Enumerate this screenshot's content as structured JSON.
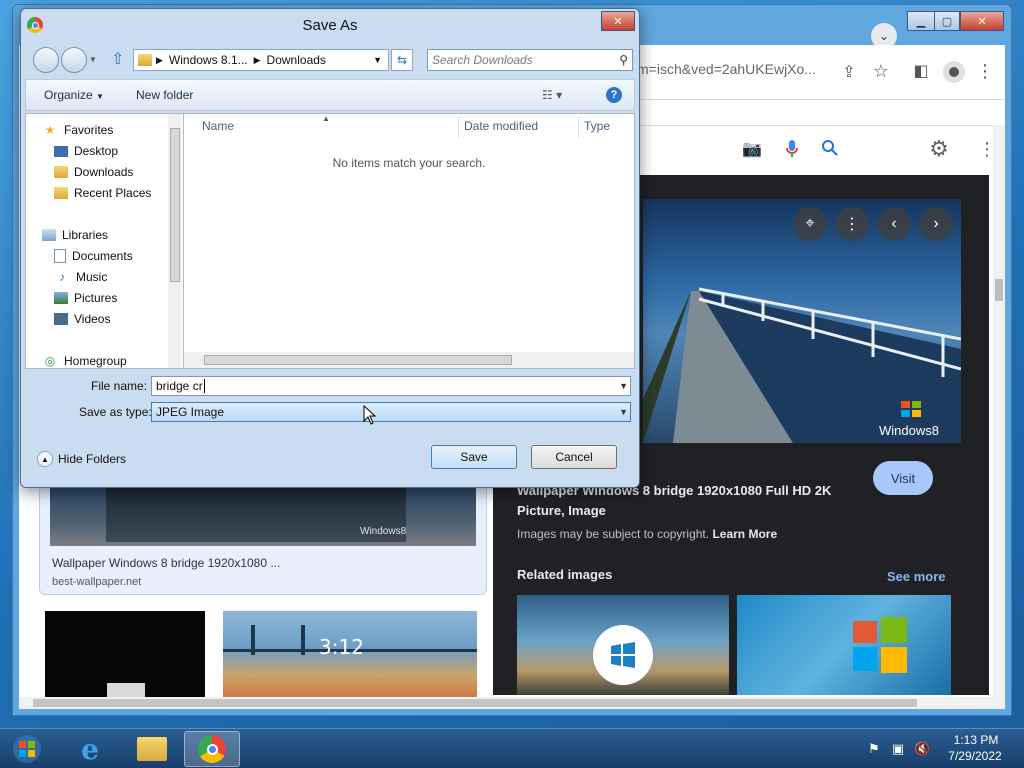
{
  "browser": {
    "url_fragment": "m=isch&ved=2ahUKEwjXo...",
    "window_controls": [
      "minimize",
      "maximize",
      "close"
    ]
  },
  "results": {
    "selected_title": "Wallpaper Windows 8 bridge 1920x1080 ...",
    "selected_source": "best-wallpaper.net",
    "thumb_watermark": "Windows8",
    "thumb_clock": "3:12"
  },
  "preview": {
    "watermark": "Windows8",
    "visit_label": "Visit",
    "title": "Wallpaper Windows 8 bridge 1920x1080 Full HD 2K Picture, Image",
    "copyright_text": "Images may be subject to copyright.",
    "learn_more": "Learn More",
    "related_heading": "Related images",
    "see_more": "See more"
  },
  "dialog": {
    "title": "Save As",
    "breadcrumb": [
      "Windows 8.1...",
      "Downloads"
    ],
    "search_placeholder": "Search Downloads",
    "organize_label": "Organize",
    "new_folder_label": "New folder",
    "columns": [
      "Name",
      "Date modified",
      "Type"
    ],
    "empty_message": "No items match your search.",
    "nav": {
      "favorites": "Favorites",
      "desktop": "Desktop",
      "downloads": "Downloads",
      "recent": "Recent Places",
      "libraries": "Libraries",
      "documents": "Documents",
      "music": "Music",
      "pictures": "Pictures",
      "videos": "Videos",
      "homegroup": "Homegroup"
    },
    "file_name_label": "File name:",
    "file_name_value": "bridge cr",
    "save_type_label": "Save as type:",
    "save_type_value": "JPEG Image",
    "hide_folders_label": "Hide Folders",
    "save_label": "Save",
    "cancel_label": "Cancel"
  },
  "taskbar": {
    "time": "1:13 PM",
    "date": "7/29/2022"
  },
  "colors": {
    "accent": "#1a73e8",
    "dark_panel": "#202124",
    "visit_button": "#a8c7fa"
  }
}
